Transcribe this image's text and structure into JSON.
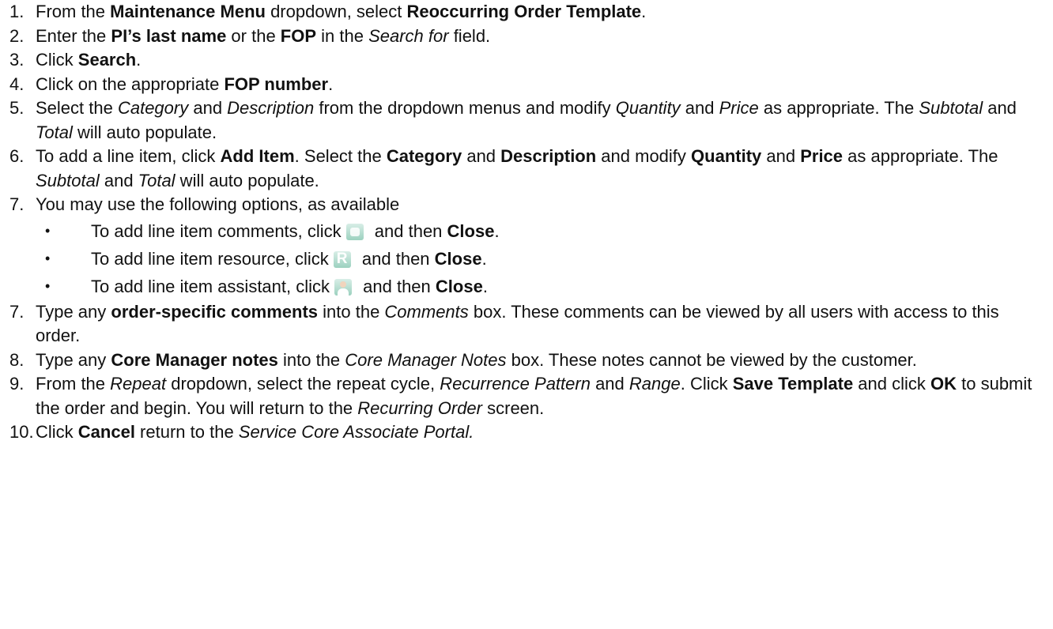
{
  "steps": [
    {
      "num": "1.",
      "segs": [
        [
          "",
          "From the "
        ],
        [
          "b",
          "Maintenance Menu"
        ],
        [
          "",
          " dropdown, select "
        ],
        [
          "b",
          "Reoccurring Order Template"
        ],
        [
          "",
          "."
        ]
      ]
    },
    {
      "num": "2.",
      "segs": [
        [
          "",
          "Enter the "
        ],
        [
          "b",
          "PI’s last name"
        ],
        [
          "",
          " or the "
        ],
        [
          "b",
          "FOP"
        ],
        [
          "",
          " in the "
        ],
        [
          "i",
          "Search for"
        ],
        [
          "",
          " field."
        ]
      ]
    },
    {
      "num": "3.",
      "segs": [
        [
          "",
          "Click "
        ],
        [
          "b",
          "Search"
        ],
        [
          "",
          "."
        ]
      ]
    },
    {
      "num": "4.",
      "segs": [
        [
          "",
          "Click on the appropriate "
        ],
        [
          "b",
          "FOP number"
        ],
        [
          "",
          "."
        ]
      ]
    },
    {
      "num": "5.",
      "segs": [
        [
          "",
          "Select the "
        ],
        [
          "i",
          "Category"
        ],
        [
          "",
          " and "
        ],
        [
          "i",
          "Description"
        ],
        [
          "",
          " from the dropdown menus and modify "
        ],
        [
          "i",
          "Quantity"
        ],
        [
          "",
          " and "
        ],
        [
          "i",
          "Price"
        ],
        [
          "",
          " as appropriate. The "
        ],
        [
          "i",
          "Subtotal"
        ],
        [
          "",
          " and "
        ],
        [
          "i",
          "Total"
        ],
        [
          "",
          " will auto populate."
        ]
      ]
    },
    {
      "num": "6.",
      "segs": [
        [
          "",
          "To add a line item, click "
        ],
        [
          "b",
          "Add Item"
        ],
        [
          "",
          ". Select the "
        ],
        [
          "b",
          "Category"
        ],
        [
          "",
          " and "
        ],
        [
          "b",
          "Description"
        ],
        [
          "",
          " and modify "
        ],
        [
          "b",
          "Quantity"
        ],
        [
          "",
          " and "
        ],
        [
          "b",
          "Price"
        ],
        [
          "",
          " as appropriate. The "
        ],
        [
          "i",
          "Subtotal"
        ],
        [
          "",
          " and "
        ],
        [
          "i",
          "Total"
        ],
        [
          "",
          " will auto populate."
        ]
      ]
    },
    {
      "num": "7.",
      "segs": [
        [
          "",
          "You may use the following options, as available"
        ]
      ],
      "options": [
        {
          "bullet": "•",
          "before": "To add line item comments, click",
          "icon": "comment-icon",
          "cls": "c",
          "after_pre": " and then ",
          "after_bold": "Close",
          "after_post": "."
        },
        {
          "bullet": "•",
          "before": "To add line item resource, click",
          "icon": "resource-icon",
          "cls": "r",
          "after_pre": " and then ",
          "after_bold": "Close",
          "after_post": "."
        },
        {
          "bullet": "•",
          "before": "To add line item assistant, click",
          "icon": "assistant-icon",
          "cls": "a",
          "after_pre": " and then ",
          "after_bold": "Close",
          "after_post": "."
        }
      ]
    },
    {
      "num": "7.",
      "segs": [
        [
          "",
          "Type any "
        ],
        [
          "b",
          "order-specific comments"
        ],
        [
          "",
          " into the "
        ],
        [
          "i",
          "Comments"
        ],
        [
          "",
          " box. These comments can be viewed by all users with access to this order."
        ]
      ]
    },
    {
      "num": "8.",
      "segs": [
        [
          "",
          "Type any "
        ],
        [
          "b",
          "Core Manager notes"
        ],
        [
          "",
          " into the "
        ],
        [
          "i",
          "Core Manager Notes"
        ],
        [
          "",
          " box. These notes cannot be viewed by the customer."
        ]
      ]
    },
    {
      "num": "9.",
      "segs": [
        [
          "",
          "From the "
        ],
        [
          "i",
          "Repeat"
        ],
        [
          "",
          " dropdown, select the repeat cycle, "
        ],
        [
          "i",
          "Recurrence Pattern"
        ],
        [
          "",
          " and "
        ],
        [
          "i",
          "Range"
        ],
        [
          "",
          ". Click "
        ],
        [
          "b",
          "Save Template"
        ],
        [
          "",
          " and click "
        ],
        [
          "b",
          "OK"
        ],
        [
          "",
          " to submit the order and begin. You will return to the "
        ],
        [
          "i",
          "Recurring Order"
        ],
        [
          "",
          " screen."
        ]
      ]
    },
    {
      "num": "10.",
      "segs": [
        [
          "",
          "Click "
        ],
        [
          "b",
          "Cancel"
        ],
        [
          "",
          " return to the "
        ],
        [
          "i",
          "Service Core Associate Portal."
        ]
      ]
    }
  ]
}
